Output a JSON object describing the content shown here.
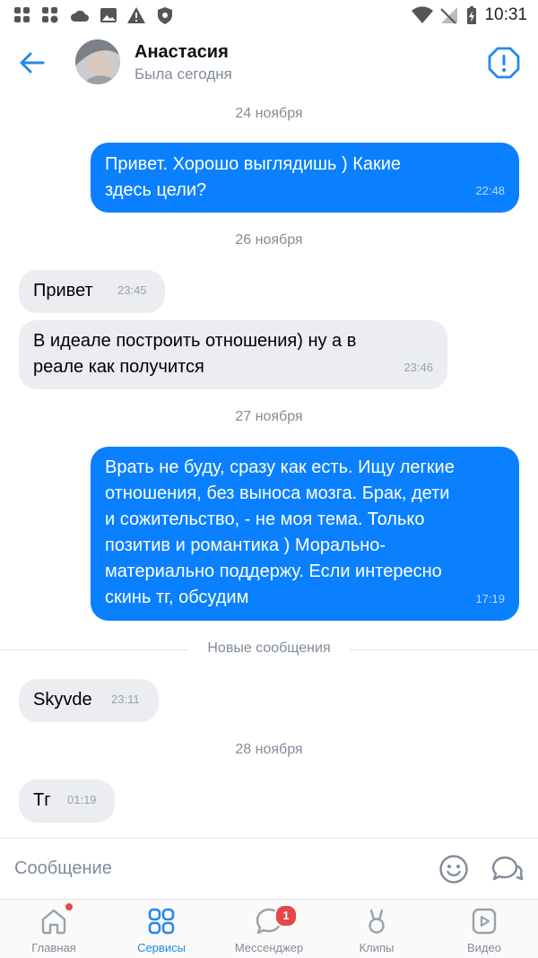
{
  "status_bar": {
    "time": "10:31"
  },
  "header": {
    "name": "Анастасия",
    "status": "Была сегодня"
  },
  "dates": {
    "d1": "24 ноября",
    "d2": "26 ноября",
    "d3": "27 ноября",
    "d4": "28 ноября"
  },
  "messages": [
    {
      "dir": "out",
      "lines": [
        "Привет. Хорошо выглядишь ) Какие",
        "здесь цели?"
      ],
      "time": "22:48"
    },
    {
      "dir": "in",
      "lines": [
        "Привет"
      ],
      "time": "23:45"
    },
    {
      "dir": "in",
      "lines": [
        "В идеале построить отношения) ну а в",
        "реале как получится"
      ],
      "time": "23:46"
    },
    {
      "dir": "out",
      "lines": [
        "Врать не буду, сразу как есть. Ищу легкие",
        "отношения, без выноса мозга. Брак, дети",
        "и сожительство, - не моя тема. Только",
        "позитив и романтика ) Морально-",
        "материально поддержу. Если интересно",
        "скинь тг, обсудим"
      ],
      "time": "17:19"
    },
    {
      "dir": "in",
      "lines": [
        "Skyvde"
      ],
      "time": "23:11"
    },
    {
      "dir": "in",
      "lines": [
        "Тг"
      ],
      "time": "01:19"
    }
  ],
  "new_messages_label": "Новые сообщения",
  "composer": {
    "placeholder": "Сообщение"
  },
  "nav": {
    "items": [
      {
        "label": "Главная",
        "icon": "home-icon"
      },
      {
        "label": "Сервисы",
        "icon": "services-icon",
        "active": true
      },
      {
        "label": "Мессенджер",
        "icon": "messenger-icon",
        "badge": "1"
      },
      {
        "label": "Клипы",
        "icon": "clips-icon"
      },
      {
        "label": "Видео",
        "icon": "video-icon"
      }
    ]
  },
  "colors": {
    "accent": "#2688eb",
    "outgoing_bubble": "#0a80ff",
    "incoming_bubble": "#ebedf0",
    "badge": "#e64646"
  }
}
